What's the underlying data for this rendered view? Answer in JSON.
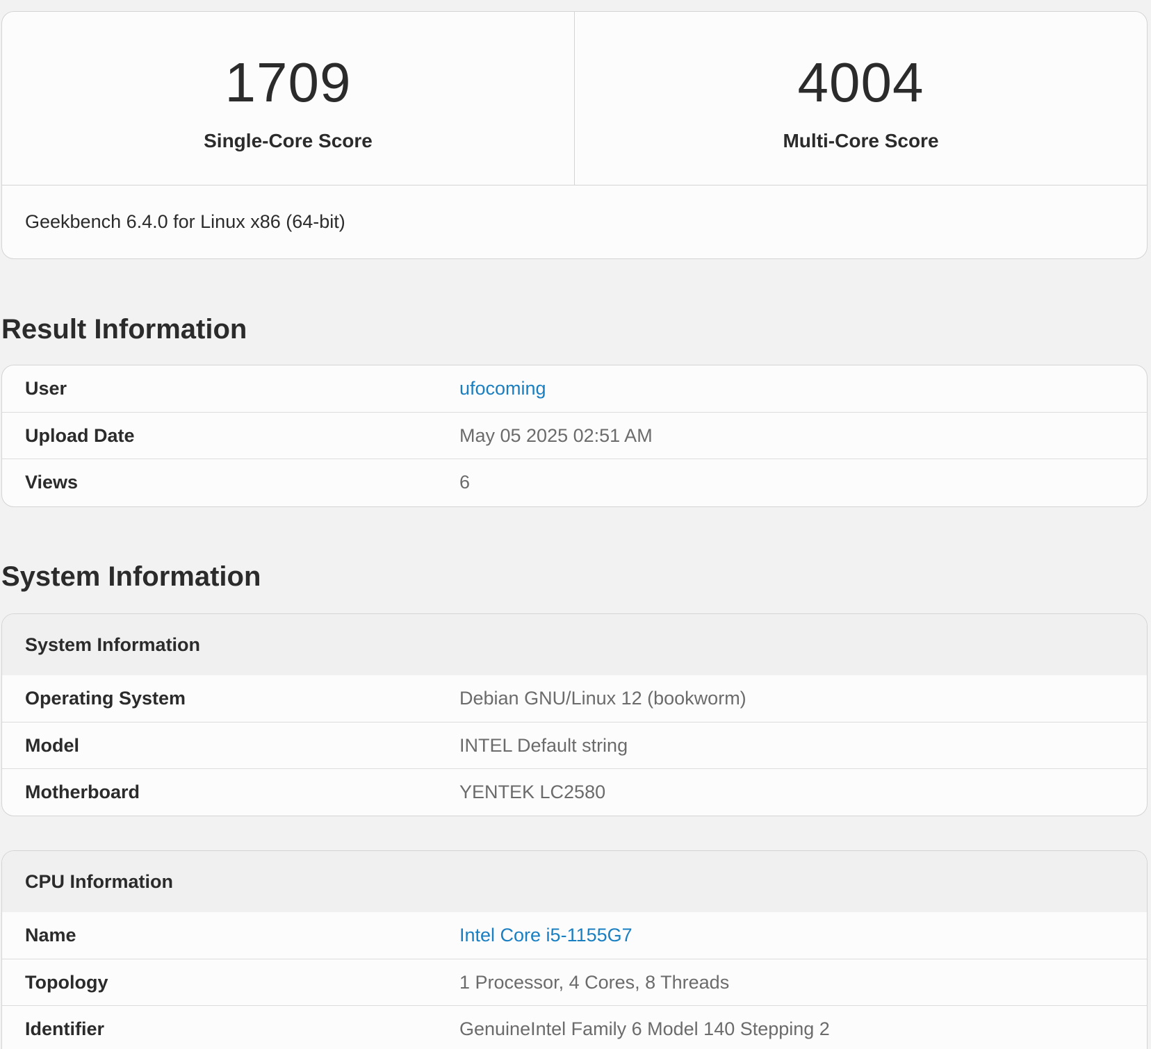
{
  "scores": {
    "single_core": {
      "value": "1709",
      "label": "Single-Core Score"
    },
    "multi_core": {
      "value": "4004",
      "label": "Multi-Core Score"
    },
    "version": "Geekbench 6.4.0 for Linux x86 (64-bit)"
  },
  "result_info": {
    "title": "Result Information",
    "rows": [
      {
        "label": "User",
        "value": "ufocoming"
      },
      {
        "label": "Upload Date",
        "value": "May 05 2025 02:51 AM"
      },
      {
        "label": "Views",
        "value": "6"
      }
    ]
  },
  "system_info": {
    "title": "System Information",
    "group_header": "System Information",
    "rows": [
      {
        "label": "Operating System",
        "value": "Debian GNU/Linux 12 (bookworm)"
      },
      {
        "label": "Model",
        "value": "INTEL Default string"
      },
      {
        "label": "Motherboard",
        "value": "YENTEK LC2580"
      }
    ]
  },
  "cpu_info": {
    "group_header": "CPU Information",
    "rows": [
      {
        "label": "Name",
        "value": "Intel Core i5-1155G7"
      },
      {
        "label": "Topology",
        "value": "1 Processor, 4 Cores, 8 Threads"
      },
      {
        "label": "Identifier",
        "value": "GenuineIntel Family 6 Model 140 Stepping 2"
      }
    ]
  },
  "colors": {
    "link": "#1a7fc1",
    "background": "#f2f2f2",
    "card": "#fcfcfc"
  }
}
